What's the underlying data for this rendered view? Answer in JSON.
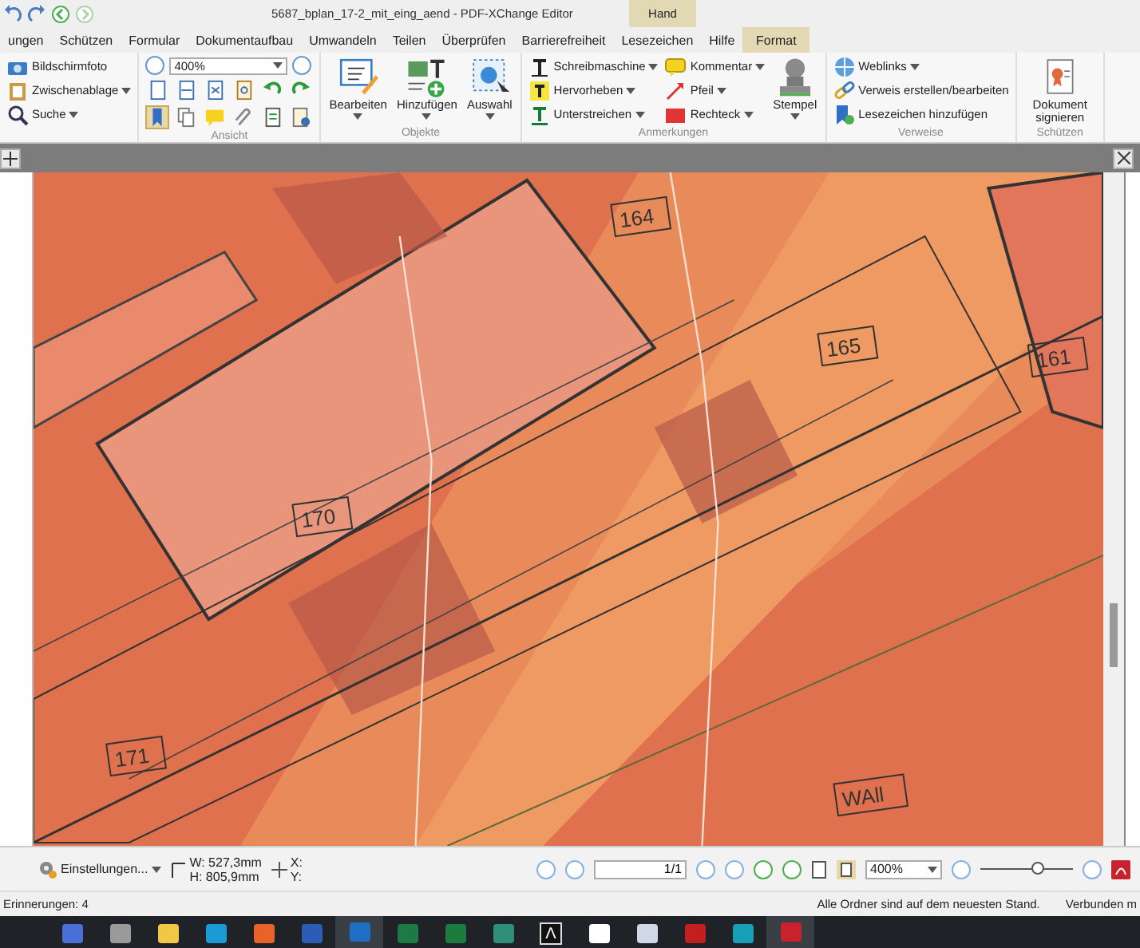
{
  "window": {
    "title": "5687_bplan_17-2_mit_eing_aend - PDF-XChange Editor",
    "context_group": "Hand"
  },
  "menu_tabs": [
    {
      "label": "ungen",
      "kind": "normal",
      "selected": false
    },
    {
      "label": "Schützen",
      "kind": "normal",
      "selected": false
    },
    {
      "label": "Formular",
      "kind": "normal",
      "selected": false
    },
    {
      "label": "Dokumentaufbau",
      "kind": "normal",
      "selected": false
    },
    {
      "label": "Umwandeln",
      "kind": "normal",
      "selected": false
    },
    {
      "label": "Teilen",
      "kind": "normal",
      "selected": false
    },
    {
      "label": "Überprüfen",
      "kind": "normal",
      "selected": false
    },
    {
      "label": "Barrierefreiheit",
      "kind": "normal",
      "selected": false
    },
    {
      "label": "Lesezeichen",
      "kind": "normal",
      "selected": false
    },
    {
      "label": "Hilfe",
      "kind": "normal",
      "selected": false
    },
    {
      "label": "Format",
      "kind": "context",
      "selected": false
    }
  ],
  "ribbon": [
    {
      "items": [
        {
          "kind": "small",
          "label": "Bildschirmfoto",
          "dropdown": false
        },
        {
          "kind": "small",
          "label": "Zwischenablage",
          "dropdown": true
        },
        {
          "kind": "small",
          "label": "Suche",
          "dropdown": true
        }
      ]
    },
    {
      "label": "Ansicht",
      "items": [
        {
          "kind": "view",
          "zoom": "400%",
          "tools": [
            {
              "selected": false
            },
            {
              "selected": false
            },
            {
              "selected": false
            },
            {
              "selected": false
            },
            {
              "selected": false
            },
            {
              "selected": false
            },
            {
              "selected": true
            },
            {
              "selected": false
            },
            {
              "selected": false
            },
            {
              "selected": false
            },
            {
              "selected": false
            },
            {
              "selected": false
            }
          ]
        }
      ]
    },
    {
      "label": "Objekte",
      "items": [
        {
          "kind": "large",
          "label": "Bearbeiten",
          "dropdown": true
        },
        {
          "kind": "large",
          "label": "Hinzufügen",
          "dropdown": true
        },
        {
          "kind": "large",
          "label": "Auswahl",
          "dropdown": true
        }
      ]
    },
    {
      "label": "Anmerkungen",
      "items": [
        {
          "kind": "small",
          "label": "Schreibmaschine",
          "dropdown": true
        },
        {
          "kind": "small",
          "label": "Hervorheben",
          "dropdown": true
        },
        {
          "kind": "small",
          "label": "Unterstreichen",
          "dropdown": true
        },
        {
          "kind": "small",
          "label": "Kommentar",
          "dropdown": true
        },
        {
          "kind": "small",
          "label": "Pfeil",
          "dropdown": true
        },
        {
          "kind": "small",
          "label": "Rechteck",
          "dropdown": true
        },
        {
          "kind": "large",
          "label": "Stempel",
          "dropdown": true
        }
      ]
    },
    {
      "label": "Verweise",
      "items": [
        {
          "kind": "small",
          "label": "Weblinks",
          "dropdown": true
        },
        {
          "kind": "small",
          "label": "Verweis erstellen/bearbeiten",
          "dropdown": false
        },
        {
          "kind": "small",
          "label": "Lesezeichen hinzufügen",
          "dropdown": false
        }
      ]
    },
    {
      "label": "Schützen",
      "items": [
        {
          "kind": "large",
          "label": "Dokument signieren",
          "dropdown": false
        }
      ]
    }
  ],
  "document": {
    "plan_numbers": [
      "164",
      "165",
      "161",
      "170",
      "171",
      "WAll"
    ]
  },
  "bottom_toolbar": {
    "settings": "Einstellungen...",
    "width": "W: 527,3mm",
    "height": "H: 805,9mm",
    "x": "X:",
    "y": "Y:",
    "page": "1/1",
    "zoom": "400%",
    "zoom_slider": {
      "level": 0.62
    }
  },
  "status_bar": {
    "left": "Erinnerungen: 4",
    "middle": "Alle Ordner sind auf dem neuesten Stand.",
    "right": "Verbunden m"
  },
  "taskbar": [
    {
      "kind": "tile",
      "color": "#4a6fd6",
      "selected": false
    },
    {
      "kind": "tile",
      "color": "#9a9a9a",
      "selected": false
    },
    {
      "kind": "tile",
      "color": "#f2c744",
      "selected": false
    },
    {
      "kind": "tile",
      "color": "#1a9ad6",
      "selected": false
    },
    {
      "kind": "tile",
      "color": "#e8632a",
      "selected": false
    },
    {
      "kind": "tile",
      "color": "#2b5db8",
      "selected": false
    },
    {
      "kind": "tile",
      "color": "#1f6fc4",
      "selected": true
    },
    {
      "kind": "tile",
      "color": "#1e7a45",
      "selected": false
    },
    {
      "kind": "tile",
      "color": "#1d7b40",
      "selected": false
    },
    {
      "kind": "tile",
      "color": "#2d8f7a",
      "selected": false
    },
    {
      "kind": "glyph",
      "glyph": "Λ",
      "selected": false
    },
    {
      "kind": "tile",
      "color": "#ffffff",
      "selected": false
    },
    {
      "kind": "tile",
      "color": "#cfd8e6",
      "selected": false
    },
    {
      "kind": "tile",
      "color": "#c41f1f",
      "selected": false
    },
    {
      "kind": "tile",
      "color": "#17a0b5",
      "selected": false
    },
    {
      "kind": "tile",
      "color": "#c8232c",
      "selected": true
    }
  ]
}
